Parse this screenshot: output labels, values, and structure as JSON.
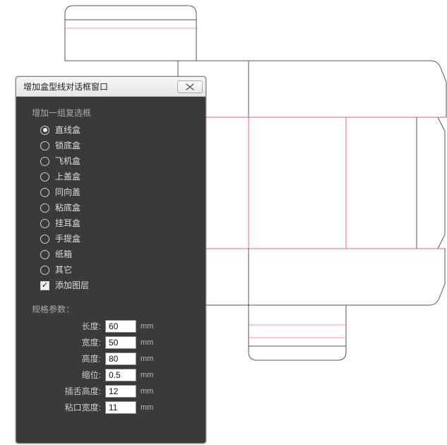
{
  "dialog": {
    "title": "增加盒型线对话框窗口",
    "group_label": "增加一组复选框",
    "options": [
      {
        "label": "直线盒",
        "selected": true
      },
      {
        "label": "锁底盒",
        "selected": false
      },
      {
        "label": "飞机盒",
        "selected": false
      },
      {
        "label": "上盖盒",
        "selected": false
      },
      {
        "label": "同向盖",
        "selected": false
      },
      {
        "label": "粘底盒",
        "selected": false
      },
      {
        "label": "挂耳盒",
        "selected": false
      },
      {
        "label": "手提盒",
        "selected": false
      },
      {
        "label": "纸箱",
        "selected": false
      },
      {
        "label": "其它",
        "selected": false
      }
    ],
    "add_layer": {
      "label": "添加图层",
      "checked": true
    },
    "spec_label": "规格参数：",
    "fields": {
      "length": {
        "label": "长度:",
        "value": "60",
        "unit": "mm"
      },
      "width": {
        "label": "宽度:",
        "value": "50",
        "unit": "mm"
      },
      "height": {
        "label": "高度:",
        "value": "80",
        "unit": "mm"
      },
      "indent": {
        "label": "缩位:",
        "value": "0.5",
        "unit": "mm"
      },
      "tongue": {
        "label": "插舌高度:",
        "value": "12",
        "unit": "mm"
      },
      "glue": {
        "label": "粘口宽度:",
        "value": "11",
        "unit": "mm"
      }
    }
  }
}
